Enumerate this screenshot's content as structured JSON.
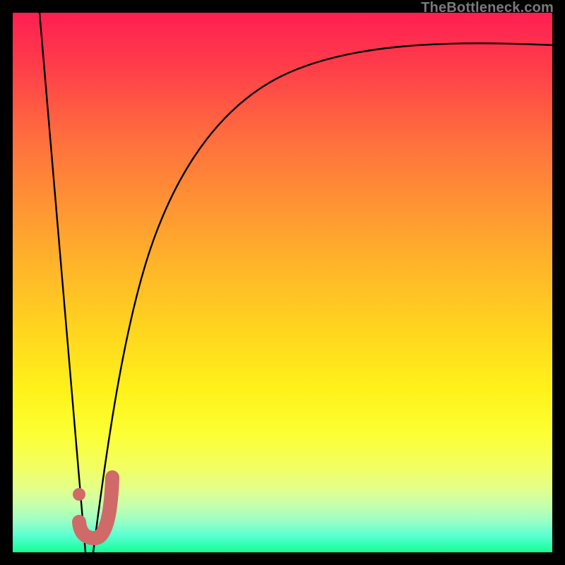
{
  "watermark": {
    "text": "TheBottleneck.com"
  },
  "chart_data": {
    "type": "line",
    "title": "",
    "xlabel": "",
    "ylabel": "",
    "xlim": [
      0,
      100
    ],
    "ylim": [
      0,
      100
    ],
    "gradient_axis": "y",
    "gradient_meaning": "top=bad (red), bottom=good (green)",
    "series": [
      {
        "name": "left-slope",
        "x": [
          5.0,
          13.5
        ],
        "y": [
          100,
          0
        ],
        "style": "straight"
      },
      {
        "name": "right-curve",
        "x": [
          15,
          18,
          22,
          27,
          33,
          40,
          48,
          57,
          67,
          78,
          88,
          100
        ],
        "y": [
          0,
          20,
          40,
          55,
          67,
          76,
          82,
          86.5,
          89.5,
          91.5,
          93,
          94
        ],
        "style": "asymptotic"
      }
    ],
    "annotations": [
      {
        "name": "j-dot",
        "x": 12.3,
        "y": 10.8
      },
      {
        "name": "j-hook",
        "shape": "J",
        "x_range": [
          12.3,
          18.5
        ],
        "y_range": [
          2.8,
          13.8
        ]
      }
    ]
  }
}
